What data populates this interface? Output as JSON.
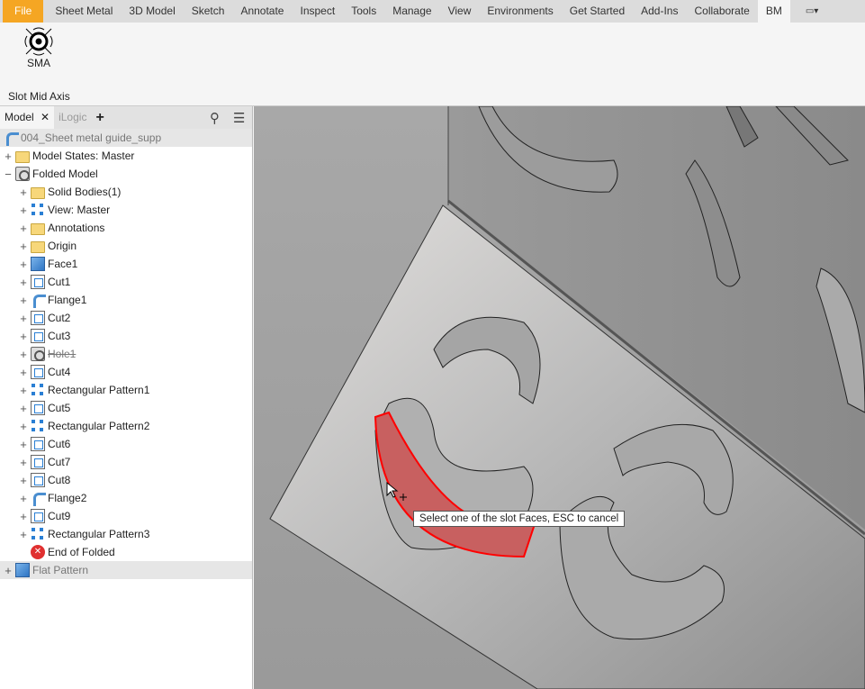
{
  "ribbon_tabs": [
    "File",
    "Sheet Metal",
    "3D Model",
    "Sketch",
    "Annotate",
    "Inspect",
    "Tools",
    "Manage",
    "View",
    "Environments",
    "Get Started",
    "Add-Ins",
    "Collaborate",
    "BM"
  ],
  "active_tab": "BM",
  "ribbon": {
    "button_label": "SMA",
    "panel_label": "Slot Mid Axis"
  },
  "browser": {
    "tabs": {
      "model": "Model",
      "ilogic": "iLogic"
    },
    "root": "004_Sheet metal guide_supp",
    "items": [
      {
        "label": "Model States: Master",
        "icon": "folder",
        "level": 0,
        "exp": "+"
      },
      {
        "label": "Folded Model",
        "icon": "folded-model",
        "level": 0,
        "exp": "−"
      },
      {
        "label": "Solid Bodies(1)",
        "icon": "folder",
        "level": 1,
        "exp": "+"
      },
      {
        "label": "View: Master",
        "icon": "view",
        "level": 1,
        "exp": "+"
      },
      {
        "label": "Annotations",
        "icon": "folder",
        "level": 1,
        "exp": "+"
      },
      {
        "label": "Origin",
        "icon": "folder",
        "level": 1,
        "exp": "+"
      },
      {
        "label": "Face1",
        "icon": "face",
        "level": 1,
        "exp": "+"
      },
      {
        "label": "Cut1",
        "icon": "cut",
        "level": 1,
        "exp": "+"
      },
      {
        "label": "Flange1",
        "icon": "flange",
        "level": 1,
        "exp": "+"
      },
      {
        "label": "Cut2",
        "icon": "cut",
        "level": 1,
        "exp": "+"
      },
      {
        "label": "Cut3",
        "icon": "cut",
        "level": 1,
        "exp": "+"
      },
      {
        "label": "Hole1",
        "icon": "hole",
        "level": 1,
        "exp": "+",
        "suppressed": true
      },
      {
        "label": "Cut4",
        "icon": "cut",
        "level": 1,
        "exp": "+"
      },
      {
        "label": "Rectangular Pattern1",
        "icon": "pattern",
        "level": 1,
        "exp": "+"
      },
      {
        "label": "Cut5",
        "icon": "cut",
        "level": 1,
        "exp": "+"
      },
      {
        "label": "Rectangular Pattern2",
        "icon": "pattern",
        "level": 1,
        "exp": "+"
      },
      {
        "label": "Cut6",
        "icon": "cut",
        "level": 1,
        "exp": "+"
      },
      {
        "label": "Cut7",
        "icon": "cut",
        "level": 1,
        "exp": "+"
      },
      {
        "label": "Cut8",
        "icon": "cut",
        "level": 1,
        "exp": "+"
      },
      {
        "label": "Flange2",
        "icon": "flange",
        "level": 1,
        "exp": "+"
      },
      {
        "label": "Cut9",
        "icon": "cut",
        "level": 1,
        "exp": "+"
      },
      {
        "label": "Rectangular Pattern3",
        "icon": "pattern",
        "level": 1,
        "exp": "+"
      },
      {
        "label": "End of Folded",
        "icon": "error",
        "level": 1,
        "exp": ""
      },
      {
        "label": "Flat Pattern",
        "icon": "face",
        "level": 0,
        "exp": "+",
        "dim": true
      }
    ]
  },
  "tooltip": "Select one of the slot Faces, ESC to cancel",
  "colors": {
    "file_tab": "#f5a623",
    "highlight": "#ff0000"
  }
}
